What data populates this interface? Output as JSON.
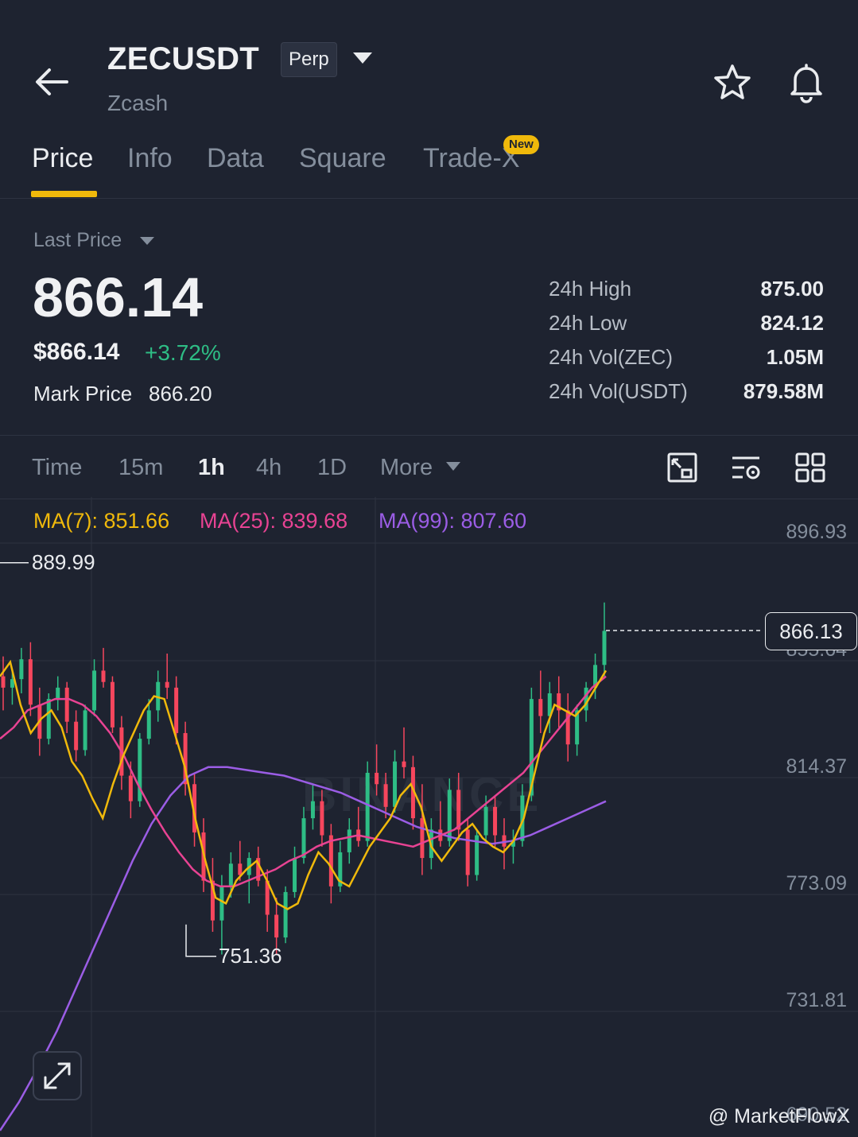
{
  "header": {
    "symbol": "ZECUSDT",
    "contract_type": "Perp",
    "coin_name": "Zcash"
  },
  "tabs": [
    {
      "label": "Price",
      "active": true
    },
    {
      "label": "Info"
    },
    {
      "label": "Data"
    },
    {
      "label": "Square"
    },
    {
      "label": "Trade-X"
    }
  ],
  "new_badge": "New",
  "price": {
    "last_price_label": "Last Price",
    "last_price": "866.14",
    "usd_price": "$866.14",
    "change_pct": "+3.72%",
    "mark_label": "Mark Price",
    "mark_value": "866.20"
  },
  "stats": [
    {
      "label": "24h High",
      "value": "875.00"
    },
    {
      "label": "24h Low",
      "value": "824.12"
    },
    {
      "label": "24h Vol(ZEC)",
      "value": "1.05M"
    },
    {
      "label": "24h Vol(USDT)",
      "value": "879.58M"
    }
  ],
  "intervals": [
    "Time",
    "15m",
    "1h",
    "4h",
    "1D",
    "More"
  ],
  "active_interval": "1h",
  "ma": {
    "ma7": "MA(7): 851.66",
    "ma25": "MA(25): 839.68",
    "ma99": "MA(99): 807.60"
  },
  "colors": {
    "up": "#2ebd85",
    "down": "#f6465d",
    "accent": "#f0b90b",
    "ma7": "#f0b90b",
    "ma25": "#e84393",
    "ma99": "#9b5de5"
  },
  "chart_data": {
    "type": "candlestick",
    "y_axis_labels": [
      "896.93",
      "855.64",
      "814.37",
      "773.09",
      "731.81",
      "690.52"
    ],
    "current_price": "866.13",
    "high_marker": "889.99",
    "low_marker": "751.36",
    "ma7_path": [
      850,
      855,
      840,
      830,
      835,
      838,
      832,
      820,
      815,
      807,
      800,
      812,
      822,
      830,
      838,
      843,
      842,
      830,
      818,
      800,
      785,
      772,
      770,
      778,
      782,
      785,
      778,
      770,
      768,
      770,
      780,
      788,
      784,
      778,
      776,
      783,
      790,
      795,
      800,
      808,
      812,
      804,
      790,
      785,
      790,
      795,
      798,
      793,
      790,
      788,
      792,
      800,
      815,
      830,
      840,
      838,
      836,
      840,
      846,
      852
    ],
    "ma25_path": [
      828,
      832,
      838,
      840,
      842,
      842,
      840,
      836,
      830,
      822,
      812,
      803,
      795,
      788,
      782,
      778,
      776,
      776,
      778,
      780,
      782,
      785,
      787,
      790,
      792,
      793,
      794,
      793,
      792,
      791,
      790,
      792,
      794,
      796,
      800,
      804,
      808,
      812,
      816,
      822,
      828,
      834,
      840,
      846,
      850
    ],
    "ma99_path": [
      690,
      700,
      712,
      725,
      740,
      755,
      770,
      785,
      798,
      808,
      815,
      818,
      818,
      817,
      816,
      815,
      813,
      811,
      809,
      806,
      803,
      800,
      797,
      795,
      793,
      792,
      791,
      792,
      794,
      797,
      800,
      803,
      806
    ],
    "candles": [
      [
        850,
        857,
        838,
        846
      ],
      [
        846,
        852,
        840,
        849
      ],
      [
        849,
        860,
        844,
        856
      ],
      [
        856,
        862,
        836,
        840
      ],
      [
        840,
        846,
        822,
        828
      ],
      [
        828,
        844,
        826,
        842
      ],
      [
        842,
        850,
        838,
        846
      ],
      [
        846,
        848,
        830,
        834
      ],
      [
        834,
        838,
        820,
        824
      ],
      [
        824,
        840,
        822,
        838
      ],
      [
        838,
        856,
        836,
        852
      ],
      [
        852,
        860,
        846,
        848
      ],
      [
        848,
        850,
        830,
        832
      ],
      [
        832,
        836,
        810,
        815
      ],
      [
        815,
        820,
        800,
        806
      ],
      [
        806,
        830,
        804,
        828
      ],
      [
        828,
        842,
        826,
        838
      ],
      [
        838,
        852,
        834,
        848
      ],
      [
        848,
        858,
        842,
        846
      ],
      [
        846,
        850,
        826,
        830
      ],
      [
        830,
        834,
        808,
        812
      ],
      [
        812,
        816,
        790,
        795
      ],
      [
        795,
        800,
        774,
        778
      ],
      [
        778,
        786,
        760,
        764
      ],
      [
        764,
        780,
        752,
        776
      ],
      [
        776,
        788,
        772,
        784
      ],
      [
        784,
        792,
        778,
        780
      ],
      [
        780,
        788,
        770,
        786
      ],
      [
        786,
        790,
        776,
        778
      ],
      [
        778,
        782,
        760,
        766
      ],
      [
        766,
        772,
        752,
        758
      ],
      [
        758,
        776,
        756,
        774
      ],
      [
        774,
        790,
        772,
        786
      ],
      [
        786,
        804,
        784,
        800
      ],
      [
        800,
        812,
        796,
        806
      ],
      [
        806,
        810,
        790,
        794
      ],
      [
        794,
        798,
        770,
        776
      ],
      [
        776,
        792,
        774,
        788
      ],
      [
        788,
        800,
        784,
        796
      ],
      [
        796,
        804,
        790,
        792
      ],
      [
        792,
        820,
        790,
        816
      ],
      [
        816,
        826,
        808,
        812
      ],
      [
        812,
        816,
        800,
        804
      ],
      [
        804,
        824,
        802,
        820
      ],
      [
        820,
        832,
        814,
        818
      ],
      [
        818,
        822,
        796,
        800
      ],
      [
        800,
        812,
        780,
        786
      ],
      [
        786,
        800,
        782,
        796
      ],
      [
        796,
        806,
        790,
        792
      ],
      [
        792,
        814,
        790,
        810
      ],
      [
        810,
        816,
        792,
        796
      ],
      [
        796,
        800,
        776,
        780
      ],
      [
        780,
        796,
        778,
        794
      ],
      [
        794,
        808,
        792,
        804
      ],
      [
        804,
        808,
        790,
        794
      ],
      [
        794,
        800,
        782,
        790
      ],
      [
        790,
        796,
        784,
        792
      ],
      [
        792,
        812,
        790,
        808
      ],
      [
        808,
        846,
        806,
        842
      ],
      [
        842,
        852,
        830,
        836
      ],
      [
        836,
        848,
        830,
        844
      ],
      [
        844,
        850,
        832,
        838
      ],
      [
        838,
        844,
        820,
        826
      ],
      [
        826,
        840,
        822,
        838
      ],
      [
        838,
        848,
        834,
        846
      ],
      [
        846,
        858,
        842,
        854
      ],
      [
        854,
        876,
        850,
        866
      ]
    ]
  },
  "credit": "@ MarketFlowX",
  "watermark": "BINANCE"
}
